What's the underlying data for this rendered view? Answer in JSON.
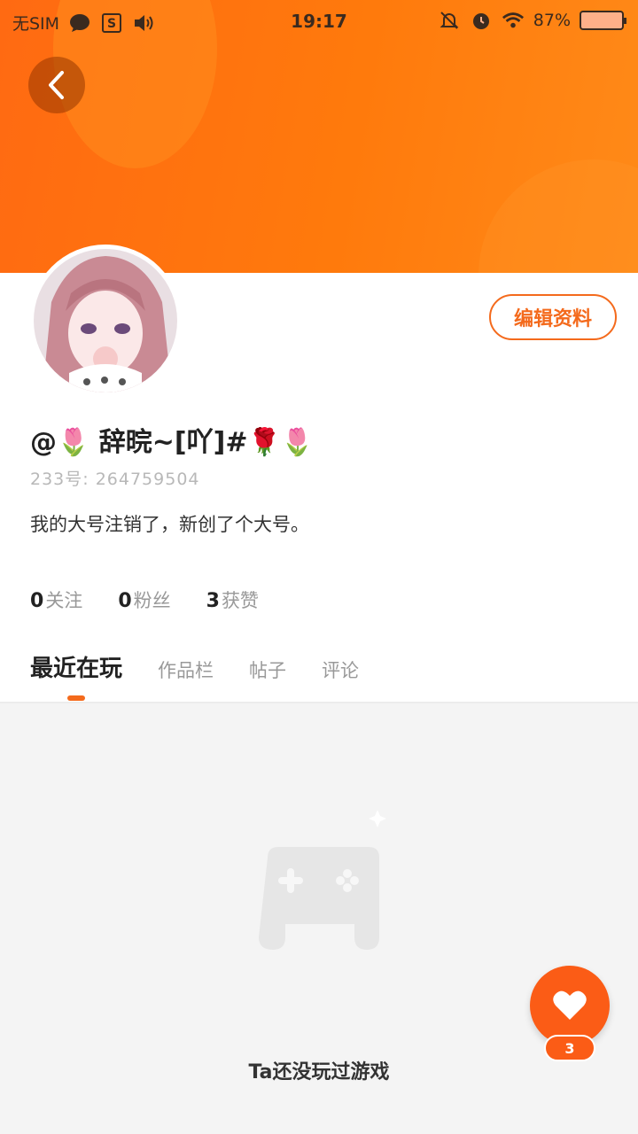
{
  "status_bar": {
    "carrier": "无SIM",
    "time": "19:17",
    "battery_percent": "87%"
  },
  "profile": {
    "nickname": "@🌷 辞晥~[吖]#🌹🌷",
    "uid": "233号: 264759504",
    "bio": "我的大号注销了，新创了个大号。",
    "edit_button": "编辑资料",
    "stats": [
      {
        "value": "0",
        "label": "关注"
      },
      {
        "value": "0",
        "label": "粉丝"
      },
      {
        "value": "3",
        "label": "获赞"
      }
    ]
  },
  "tabs": [
    {
      "label": "最近在玩",
      "active": true
    },
    {
      "label": "作品栏",
      "active": false
    },
    {
      "label": "帖子",
      "active": false
    },
    {
      "label": "评论",
      "active": false
    }
  ],
  "empty_state": {
    "message": "Ta还没玩过游戏"
  },
  "like": {
    "count": "3"
  },
  "colors": {
    "accent": "#f46a1c",
    "banner": "#ff7a0c"
  }
}
